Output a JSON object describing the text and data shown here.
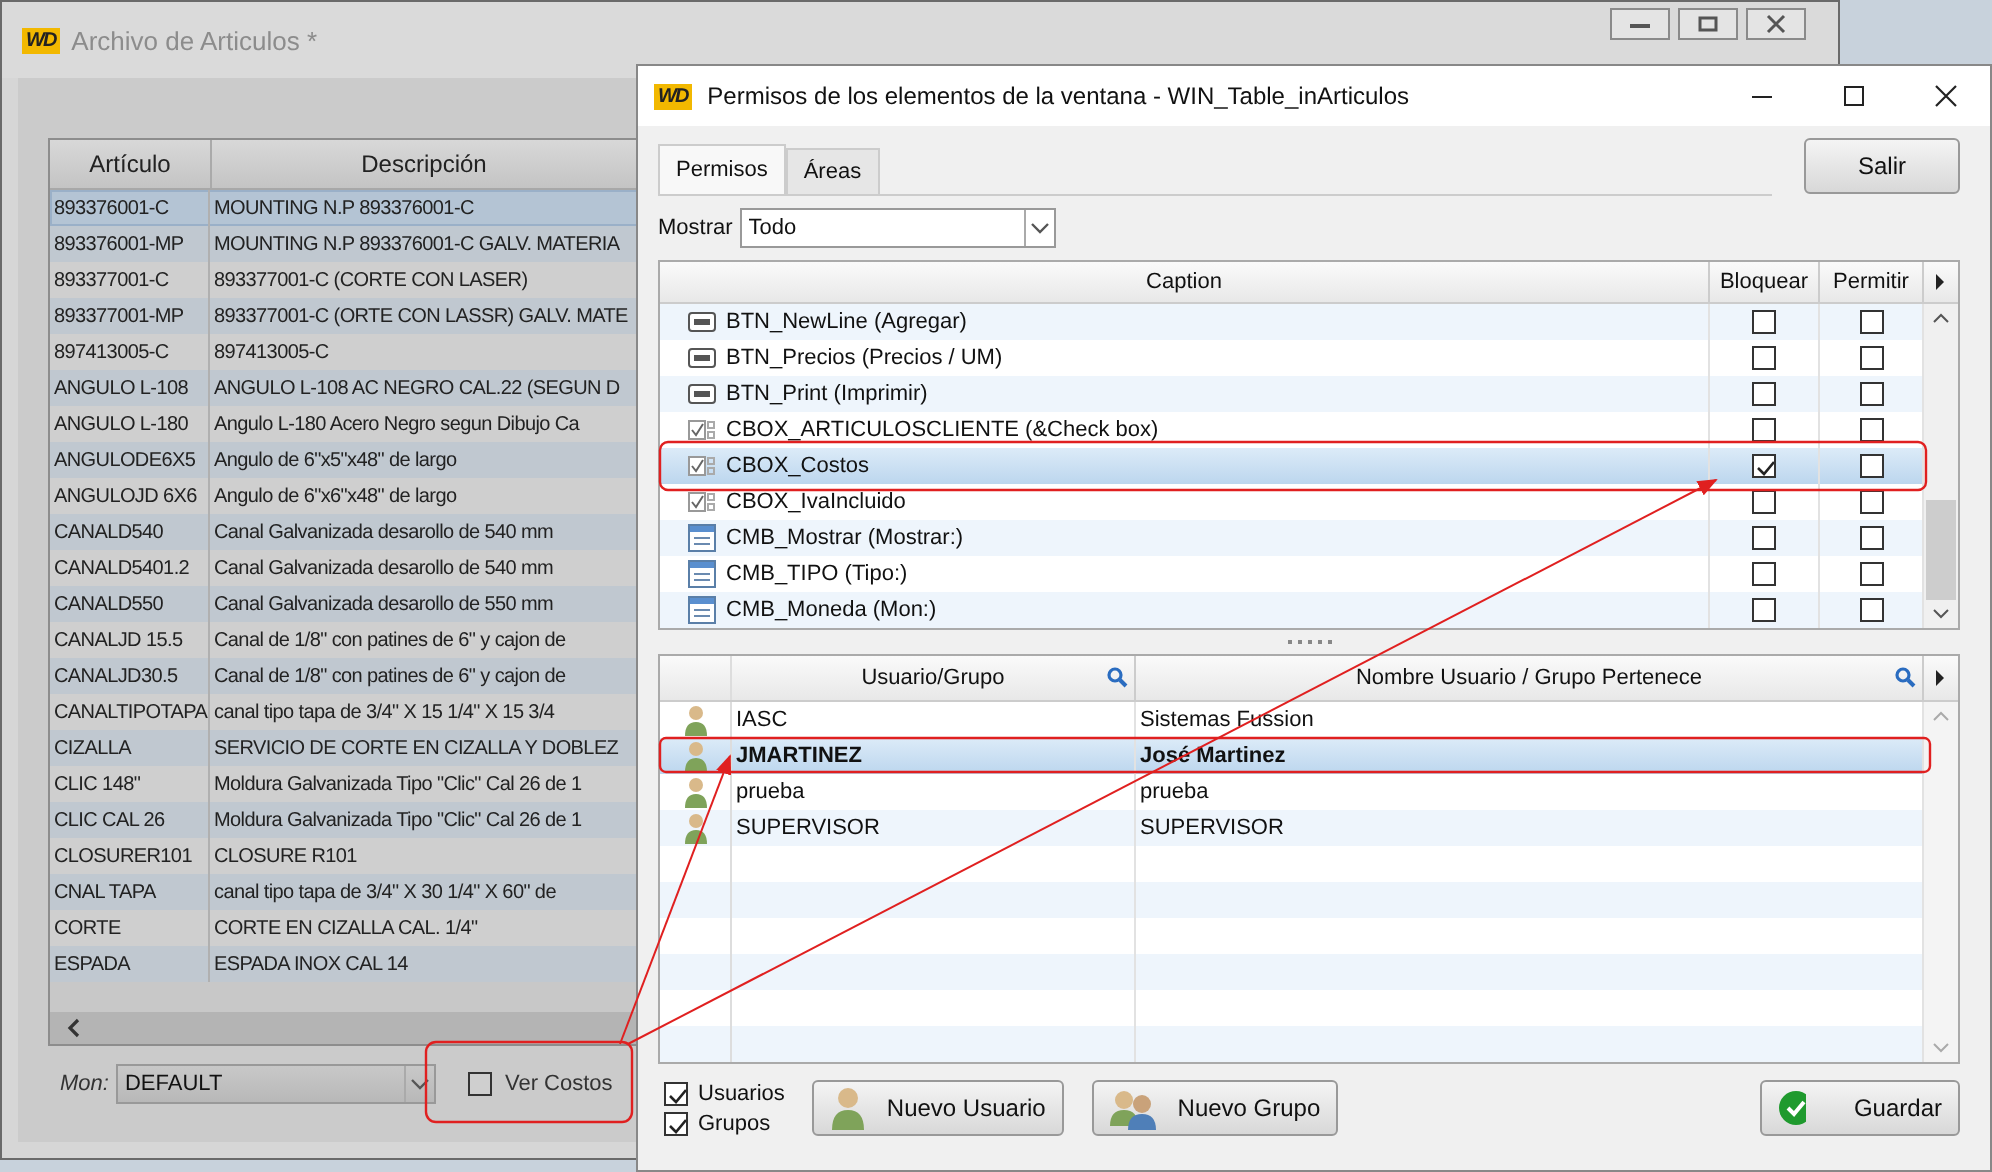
{
  "background_window": {
    "logo": "WD",
    "title": "Archivo de Articulos *",
    "table": {
      "columns": [
        "Artículo",
        "Descripción"
      ],
      "rows": [
        {
          "article": "893376001-C",
          "description": "MOUNTING N.P 893376001-C",
          "selected": true
        },
        {
          "article": "893376001-MP",
          "description": "MOUNTING N.P 893376001-C GALV. MATERIA",
          "selected": false
        },
        {
          "article": "893377001-C",
          "description": "893377001-C (CORTE CON LASER)",
          "selected": false
        },
        {
          "article": "893377001-MP",
          "description": "893377001-C (ORTE CON LASSR) GALV. MATE",
          "selected": false
        },
        {
          "article": "897413005-C",
          "description": "897413005-C",
          "selected": false
        },
        {
          "article": "ANGULO L-108",
          "description": "ANGULO L-108 AC NEGRO CAL.22 (SEGUN D",
          "selected": false
        },
        {
          "article": "ANGULO L-180",
          "description": "Angulo L-180 Acero Negro segun Dibujo Ca",
          "selected": false
        },
        {
          "article": "ANGULODE6X5",
          "description": "Angulo de 6\"x5\"x48\" de largo",
          "selected": false
        },
        {
          "article": "ANGULOJD 6X6",
          "description": "Angulo de 6\"x6\"x48\" de largo",
          "selected": false
        },
        {
          "article": "CANALD540",
          "description": "Canal Galvanizada desarollo de 540 mm",
          "selected": false
        },
        {
          "article": "CANALD5401.2",
          "description": "Canal Galvanizada desarollo de 540 mm",
          "selected": false
        },
        {
          "article": "CANALD550",
          "description": "Canal Galvanizada desarollo de 550 mm",
          "selected": false
        },
        {
          "article": "CANALJD 15.5",
          "description": "Canal de 1/8\" con patines de 6\" y cajon de",
          "selected": false
        },
        {
          "article": "CANALJD30.5",
          "description": "Canal de 1/8\" con patines de 6\" y cajon de",
          "selected": false
        },
        {
          "article": "CANALTIPOTAPA",
          "description": "canal tipo tapa de 3/4\" X 15 1/4\" X 15 3/4",
          "selected": false
        },
        {
          "article": "CIZALLA",
          "description": "SERVICIO DE CORTE EN CIZALLA Y DOBLEZ",
          "selected": false
        },
        {
          "article": "CLIC 148\"",
          "description": "Moldura Galvanizada Tipo \"Clic\" Cal 26 de 1",
          "selected": false
        },
        {
          "article": "CLIC CAL 26",
          "description": "Moldura Galvanizada Tipo \"Clic\" Cal 26 de 1",
          "selected": false
        },
        {
          "article": "CLOSURER101",
          "description": "CLOSURE R101",
          "selected": false
        },
        {
          "article": "CNAL TAPA",
          "description": "canal tipo tapa de 3/4\" X 30 1/4\" X 60\" de",
          "selected": false
        },
        {
          "article": "CORTE",
          "description": "CORTE EN CIZALLA CAL. 1/4\"",
          "selected": false
        },
        {
          "article": "ESPADA",
          "description": "ESPADA INOX CAL 14",
          "selected": false
        }
      ]
    },
    "currency": {
      "label": "Mon:",
      "value": "DEFAULT"
    },
    "show_costs": {
      "label": "Ver Costos",
      "checked": false
    }
  },
  "dialog": {
    "logo": "WD",
    "title": "Permisos de los elementos de la ventana - WIN_Table_inArticulos",
    "tabs": [
      {
        "label": "Permisos",
        "selected": true
      },
      {
        "label": "Áreas",
        "selected": false
      }
    ],
    "exit_button": "Salir",
    "filter": {
      "label": "Mostrar",
      "value": "Todo"
    },
    "elements": {
      "columns": [
        "Caption",
        "Bloquear",
        "Permitir"
      ],
      "rows": [
        {
          "kind": "button",
          "caption": "BTN_NewLine (Agregar)",
          "block": false,
          "allow": false,
          "selected": false
        },
        {
          "kind": "button",
          "caption": "BTN_Precios (Precios / UM)",
          "block": false,
          "allow": false,
          "selected": false
        },
        {
          "kind": "button",
          "caption": "BTN_Print (Imprimir)",
          "block": false,
          "allow": false,
          "selected": false
        },
        {
          "kind": "checkbox",
          "caption": "CBOX_ARTICULOSCLIENTE (&Check box)",
          "block": false,
          "allow": false,
          "selected": false
        },
        {
          "kind": "checkbox",
          "caption": "CBOX_Costos",
          "block": true,
          "allow": false,
          "selected": true
        },
        {
          "kind": "checkbox",
          "caption": "CBOX_IvaIncluido",
          "block": false,
          "allow": false,
          "selected": false
        },
        {
          "kind": "combo",
          "caption": "CMB_Mostrar (Mostrar:)",
          "block": false,
          "allow": false,
          "selected": false
        },
        {
          "kind": "combo",
          "caption": "CMB_TIPO (Tipo:)",
          "block": false,
          "allow": false,
          "selected": false
        },
        {
          "kind": "combo",
          "caption": "CMB_Moneda (Mon:)",
          "block": false,
          "allow": false,
          "selected": false
        }
      ]
    },
    "users": {
      "columns": [
        "Usuario/Grupo",
        "Nombre Usuario / Grupo Pertenece"
      ],
      "rows": [
        {
          "login": "IASC",
          "name": "Sistemas Fussion",
          "selected": false
        },
        {
          "login": "JMARTINEZ",
          "name": "José Martinez",
          "selected": true
        },
        {
          "login": "prueba",
          "name": "prueba",
          "selected": false
        },
        {
          "login": "SUPERVISOR",
          "name": "SUPERVISOR",
          "selected": false
        }
      ]
    },
    "filters": [
      {
        "label": "Usuarios",
        "checked": true
      },
      {
        "label": "Grupos",
        "checked": true
      }
    ],
    "new_user_button": "Nuevo Usuario",
    "new_group_button": "Nuevo Grupo",
    "save_button": "Guardar"
  }
}
